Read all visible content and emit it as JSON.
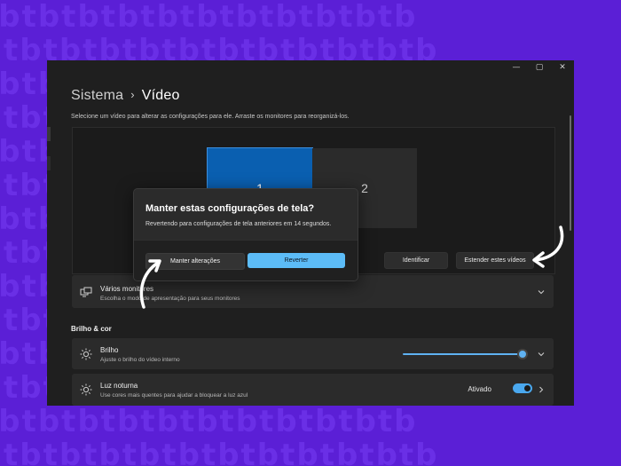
{
  "background_pattern": [
    "tbtbtbtbtbtbtbtbtbtbtb",
    "tbtbtbtbtbtbtbtbtbtbtb",
    "tbtbtbtbtbtbtbtbtbtbtb",
    "tbtbtbtbtbtbtbtbtbtbtb",
    "tbtbtbtbtbtbtbtbtbtbtb",
    "tbtbtbtbtbtbtbtbtbtbtb",
    "tbtbtbtbtbtbtbtbtbtbtb",
    "tbtbtbtbtbtbtbtbtbtbtb",
    "tbtbtbtbtbtbtbtbtbtbtb",
    "tbtbtbtbtbtbtbtbtbtbtb",
    "tbtbtbtbtbtbtbtbtbtbtb",
    "tbtbtbtbtbtbtbtbtbtbtb",
    "tbtbtbtbtbtbtbtbtbtbtb",
    "tbtbtbtbtbtbtbtbtbtbtb"
  ],
  "window_controls": {
    "minimize": "—",
    "maximize": "▢",
    "close": "✕"
  },
  "breadcrumb": {
    "parent": "Sistema",
    "separator": "›",
    "current": "Vídeo"
  },
  "subtitle": "Selecione um vídeo para alterar as configurações para ele. Arraste os monitores para reorganizá-los.",
  "monitors": [
    {
      "label": "1",
      "selected": true
    },
    {
      "label": "2",
      "selected": false
    }
  ],
  "panel_buttons": {
    "identify": "Identificar",
    "extend": "Estender estes vídeos"
  },
  "multiple_displays": {
    "title": "Vários monitores",
    "description": "Escolha o modo de apresentação para seus monitores",
    "icon": "multi-monitor-icon"
  },
  "section_brightness": "Brilho & cor",
  "brightness": {
    "title": "Brilho",
    "description": "Ajuste o brilho do vídeo interno",
    "icon": "sun-icon",
    "level": 0.96
  },
  "night_light": {
    "title": "Luz noturna",
    "description": "Use cores mais quentes para ajudar a bloquear a luz azul",
    "icon": "sun-icon",
    "status": "Ativado",
    "on": true
  },
  "dialog": {
    "title": "Manter estas configurações de tela?",
    "text": "Revertendo para configurações de tela anteriores em 14 segundos.",
    "keep_label": "Manter alterações",
    "revert_label": "Reverter"
  },
  "colors": {
    "background": "#5b1fd6",
    "accent": "#5cbcf7",
    "window": "#1f1f1f",
    "card": "#2b2b2b"
  }
}
